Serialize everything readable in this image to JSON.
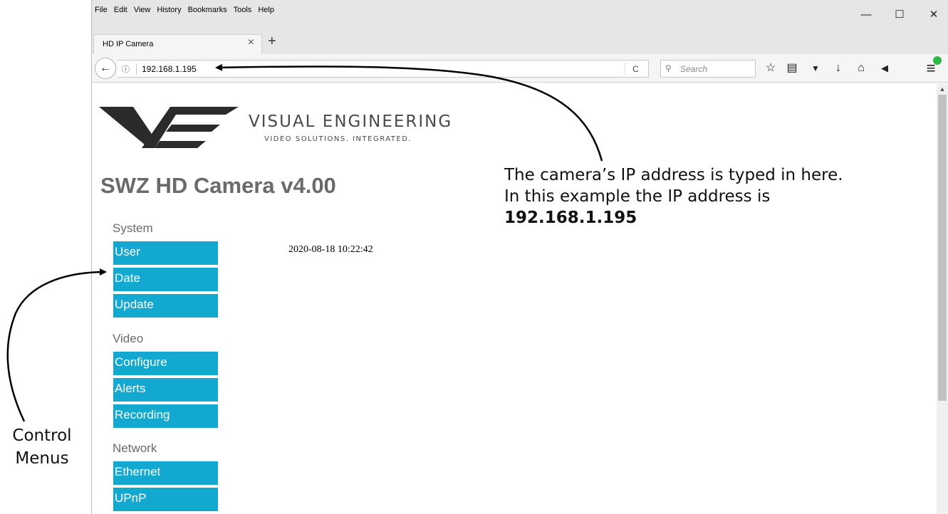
{
  "browser": {
    "menu": [
      "File",
      "Edit",
      "View",
      "History",
      "Bookmarks",
      "Tools",
      "Help"
    ],
    "window_controls": {
      "minimize": "—",
      "maximize": "☐",
      "close": "✕"
    },
    "tab": {
      "title": "HD IP Camera",
      "close": "×",
      "new_tab": "+"
    },
    "nav": {
      "back": "←",
      "info": "ⓘ",
      "url": "192.168.1.195",
      "reload": "C",
      "search_icon": "⚲",
      "search_placeholder": "Search"
    },
    "toolbar": [
      {
        "name": "bookmark-star-icon",
        "glyph": "☆"
      },
      {
        "name": "reading-list-icon",
        "glyph": "▤"
      },
      {
        "name": "pocket-icon",
        "glyph": "▼"
      },
      {
        "name": "download-icon",
        "glyph": "↓"
      },
      {
        "name": "home-icon",
        "glyph": "⌂"
      },
      {
        "name": "send-icon",
        "glyph": "◀"
      },
      {
        "name": "hamburger-menu-icon",
        "glyph": "≡"
      }
    ],
    "scroll_up": "▲"
  },
  "page": {
    "brand": "VISUAL ENGINEERING",
    "tagline": "VIDEO SOLUTIONS. INTEGRATED.",
    "title": "SWZ HD Camera v4.00",
    "datetime": "2020-08-18 10:22:42",
    "menu": {
      "system": {
        "heading": "System",
        "items": [
          "User",
          "Date",
          "Update"
        ]
      },
      "video": {
        "heading": "Video",
        "items": [
          "Configure",
          "Alerts",
          "Recording"
        ]
      },
      "network": {
        "heading": "Network",
        "items": [
          "Ethernet",
          "UPnP"
        ]
      }
    }
  },
  "annotations": {
    "ip_note_line1": "The camera’s IP address is typed in here.",
    "ip_note_line2": "In this example the IP address is",
    "ip_note_value": "192.168.1.195",
    "menus_note_line1": "Control",
    "menus_note_line2": "Menus"
  },
  "colors": {
    "menu_button": "#13a8cf",
    "title_gray": "#6a6a6a",
    "chrome_gray": "#e6e6e6"
  }
}
